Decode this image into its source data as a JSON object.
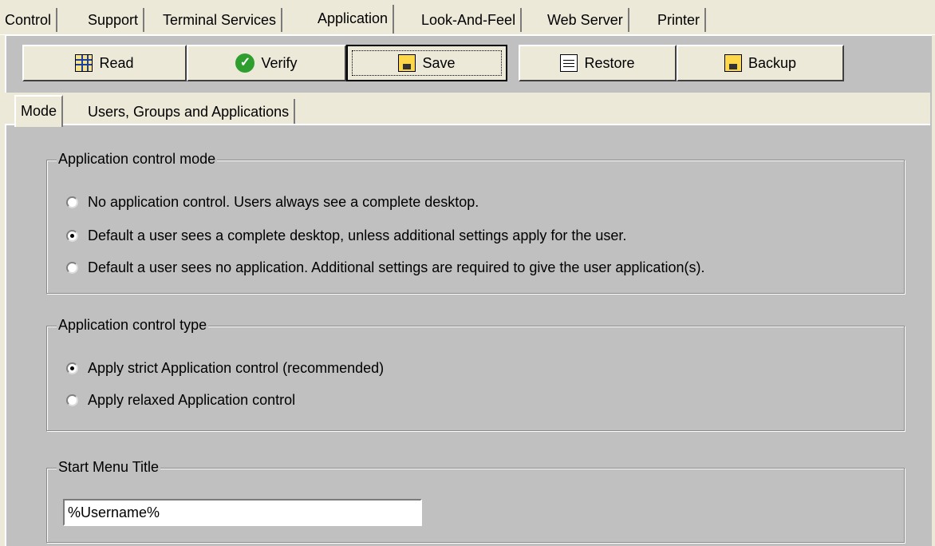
{
  "top_tabs": [
    "Control",
    "Support",
    "Terminal Services",
    "Application",
    "Look-And-Feel",
    "Web Server",
    "Printer"
  ],
  "active_top_tab": "Application",
  "toolbar": {
    "read_label": "Read",
    "verify_label": "Verify",
    "save_label": "Save",
    "restore_label": "Restore",
    "backup_label": "Backup"
  },
  "sub_tabs": [
    "Mode",
    "Users, Groups and Applications"
  ],
  "active_sub_tab": "Mode",
  "control_mode": {
    "legend": "Application control mode",
    "options": [
      {
        "label": "No application control. Users always see a complete desktop.",
        "checked": false
      },
      {
        "label": "Default a user sees a complete desktop, unless additional settings apply for the user.",
        "checked": true
      },
      {
        "label": "Default a user sees no application. Additional settings are required to give the user application(s).",
        "checked": false
      }
    ]
  },
  "control_type": {
    "legend": "Application control type",
    "options": [
      {
        "label": "Apply strict Application control (recommended)",
        "checked": true
      },
      {
        "label": "Apply relaxed Application control",
        "checked": false
      }
    ]
  },
  "start_menu": {
    "legend": "Start Menu Title",
    "value": "%Username%"
  },
  "icons": {
    "read": "grid-doc-icon",
    "verify": "checkmark-icon",
    "save": "disk-icon",
    "restore": "document-icon",
    "backup": "disk-icon"
  }
}
